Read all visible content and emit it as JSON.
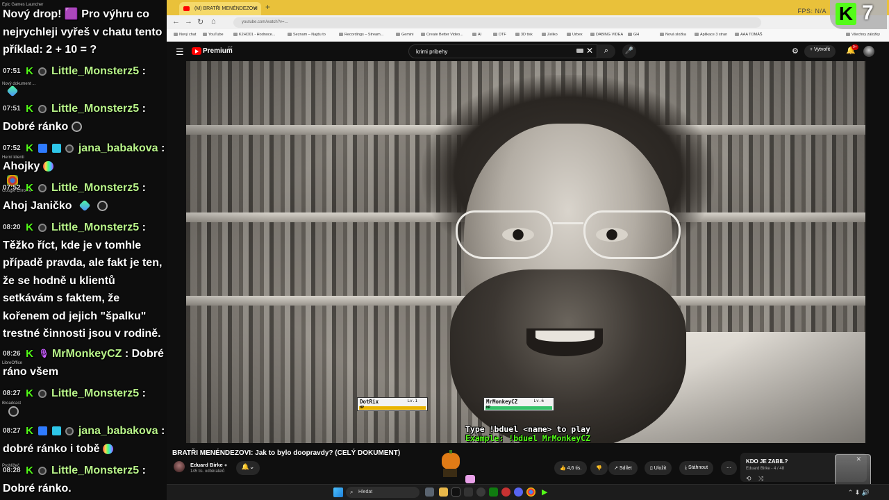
{
  "chat": {
    "messages": [
      {
        "text": "Nový drop! 🟪 Pro výhru co nejrychleji vyřeš v chatu tento příklad: 2 + 10 = ?"
      },
      {
        "time": "07:51",
        "user": "Little_Monsterz5",
        "sep": ":",
        "text": ""
      },
      {
        "time": "07:51",
        "user": "Little_Monsterz5",
        "sep": ":",
        "text": "Dobré ránko"
      },
      {
        "time": "07:52",
        "user": "jana_babakova",
        "sep": ":",
        "text": "Ahojky"
      },
      {
        "time": "07:52",
        "user": "Little_Monsterz5",
        "sep": ":",
        "text": "Ahoj Janičko"
      },
      {
        "time": "08:20",
        "user": "Little_Monsterz5",
        "sep": ":",
        "text": "Těžko říct, kde je v tomhle případě pravda, ale fakt je ten, že se hodně u klientů setkávám s faktem, že kořenem od jejich \"špalku\" trestné činnosti jsou v rodině."
      },
      {
        "time": "08:26",
        "user": "MrMonkeyCZ",
        "sep": ":",
        "text": "Dobré ráno všem"
      },
      {
        "time": "08:27",
        "user": "Little_Monsterz5",
        "sep": ":",
        "text": ""
      },
      {
        "time": "08:27",
        "user": "jana_babakova",
        "sep": ":",
        "text": "dobré ránko i tobě"
      },
      {
        "time": "08:28",
        "user": "Little_Monsterz5",
        "sep": ":",
        "text": "Dobré ránko."
      }
    ],
    "desktop_labels": [
      "Epic Games Launcher",
      "Nový dokument ...",
      "Herní klienti",
      "Google Chrome",
      "LibreOffice",
      "Broadcast",
      "Prohlížeč"
    ]
  },
  "browser": {
    "tab_title": "(M) BRATŘI MENÉNDEZOVI",
    "tab_close": "×",
    "new_tab": "+",
    "stats": "FPS: N/A",
    "url": "youtube.com/watch?v=...",
    "bookmarks": [
      "Nový chat",
      "YouTube",
      "K2HD01 - Hodnoce...",
      "Seznam – Najdu to",
      "Recordings – Stream...",
      "Gemini",
      "Create Better Video...",
      "AI",
      "DTF",
      "3D tisk",
      "Zeliko",
      "Urbex",
      "DABING VIDEA",
      "GH",
      "Nová složka",
      "Aplikace 3 stran",
      "AAA TOMÁŠ",
      "Všechny záložky"
    ]
  },
  "youtube": {
    "brand": "Premium",
    "brand_cc": "CZ",
    "search_value": "krimi pribehy",
    "create_label": "Vytvořit",
    "bell_count": "9+",
    "video_title": "BRATŘI MENÉNDEZOVI: Jak to bylo doopravdy? (CELÝ DOKUMENT)",
    "channel_name": "Eduard Birke",
    "channel_subs": "145 tis. odběratelů",
    "likes": "4,6 tis.",
    "share": "Sdílet",
    "save": "Uložit",
    "download": "Stáhnout",
    "playlist_title": "KDO JE ZABIL?",
    "playlist_meta": "Eduard Birke - 4 / 48"
  },
  "overlay": {
    "kick_number": "7",
    "player1": {
      "name": "DotRix",
      "level": "Lv.1",
      "hp": 1.0,
      "hp_label": "HP"
    },
    "player2": {
      "name": "MrMonkeyCZ",
      "level": "Lv.6",
      "hp": 1.0,
      "hp_label": "HP"
    },
    "duel_line1": "Type !bduel <name> to play",
    "duel_line2": "Example: !bduel MrMonkeyCZ"
  },
  "taskbar": {
    "search_placeholder": "Hledat"
  },
  "colors": {
    "kick_green": "#53fc18",
    "yt_red": "#ff0000",
    "tab_bar": "#e9c13a",
    "username": "#b9f58a"
  }
}
